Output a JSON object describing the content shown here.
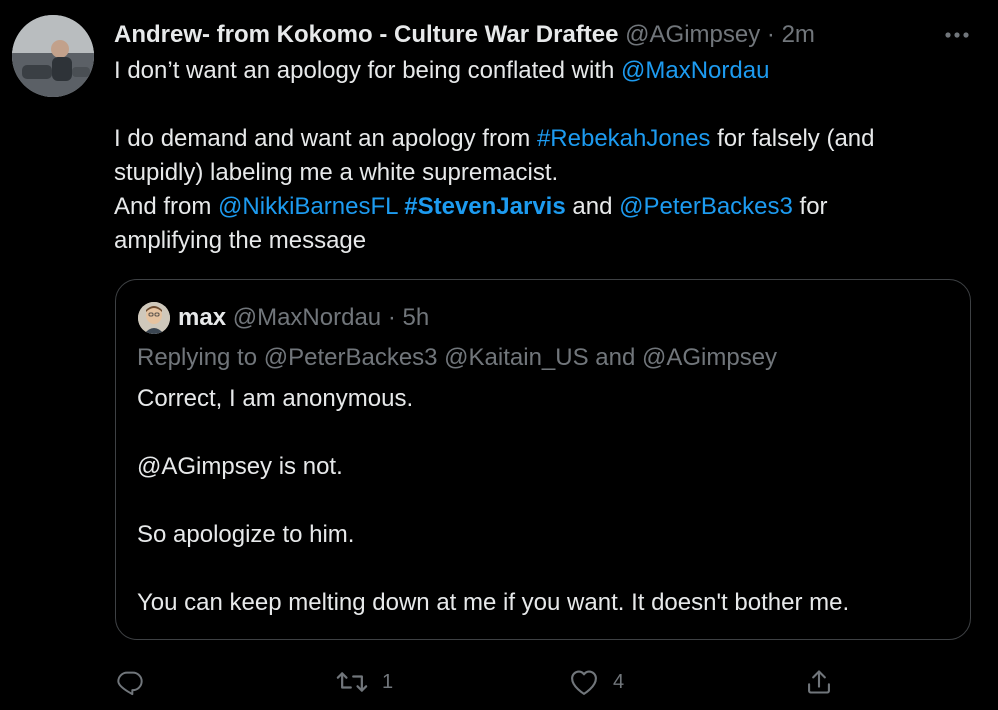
{
  "tweet": {
    "display_name": "Andrew- from Kokomo - Culture War Draftee",
    "handle": "@AGimpsey",
    "separator": "·",
    "time": "2m",
    "text": {
      "l1_pre": "I don’t want an apology for being conflated with ",
      "l1_link": "@MaxNordau",
      "l3_pre": "I do demand and want an apology from ",
      "l3_link": "#RebekahJones",
      "l3_post": " for falsely (and",
      "l4": "stupidly) labeling me a white supremacist.",
      "l5_pre": "And from ",
      "l5_link1": "@NikkiBarnesFL",
      "l5_space1": " ",
      "l5_link2": "#StevenJarvis",
      "l5_mid": " and ",
      "l5_link3": "@PeterBackes3",
      "l5_post": " for",
      "l6": "amplifying the message"
    }
  },
  "quote": {
    "name": "max",
    "handle": "@MaxNordau",
    "separator": "·",
    "time": "5h",
    "replying_to": "Replying to @PeterBackes3 @Kaitain_US and @AGimpsey",
    "lines": {
      "l1": "Correct, I am anonymous.",
      "l2": "@AGimpsey is not.",
      "l3": "So apologize to him.",
      "l4": "You can keep melting down at me if you want. It doesn't bother me."
    }
  },
  "actions": {
    "reply_icon": "reply-icon",
    "retweet_icon": "retweet-icon",
    "retweet_count": "1",
    "like_icon": "heart-icon",
    "like_count": "4",
    "share_icon": "share-icon"
  },
  "colors": {
    "background": "#000000",
    "text": "#e7e9ea",
    "secondary": "#71767b",
    "link": "#1d9bf0",
    "border": "#3e4144"
  }
}
